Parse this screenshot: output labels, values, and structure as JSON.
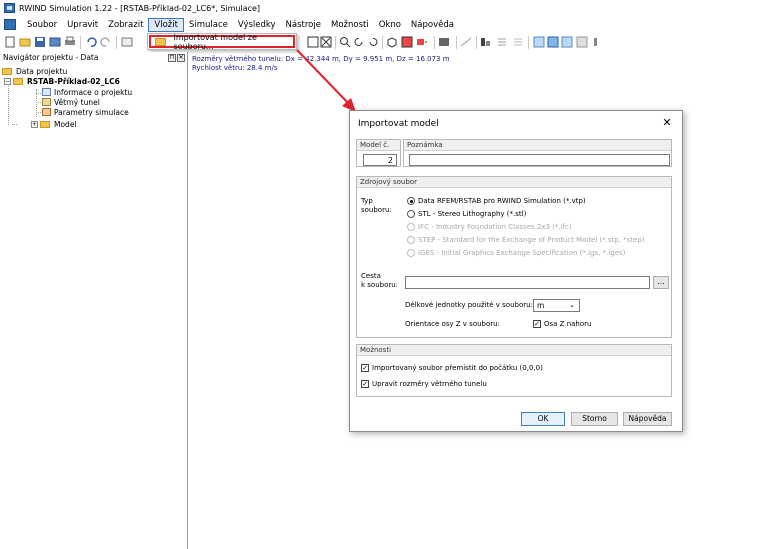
{
  "window": {
    "title": "RWIND Simulation 1.22 - [RSTAB-Příklad-02_LC6*, Simulace]"
  },
  "menu": {
    "items": [
      "Soubor",
      "Upravit",
      "Zobrazit",
      "Vložit",
      "Simulace",
      "Výsledky",
      "Nástroje",
      "Možnosti",
      "Okno",
      "Nápověda"
    ],
    "active_index": 3,
    "dropdown_item": "Importovat model ze souboru..."
  },
  "navigator": {
    "title": "Navigátor projektu - Data",
    "pin": "⊓",
    "close": "✕",
    "tree": {
      "root": "Data projektu",
      "project": "RSTAB-Příklad-02_LC6",
      "children": [
        "Informace o projektu",
        "Větrný tunel",
        "Parametry simulace",
        "Model"
      ]
    }
  },
  "info": {
    "line1": "Rozměry větrného tunelu: Dx = 42.344 m, Dy = 9.951 m, Dz = 16.073 m",
    "line2": "Rychlost větru: 28.4 m/s"
  },
  "dialog": {
    "title": "Importovat model",
    "close": "✕",
    "model": {
      "header": "Model č.",
      "value": "2"
    },
    "note": {
      "header": "Poznámka",
      "value": ""
    },
    "source": {
      "header": "Zdrojový soubor",
      "type_label_1": "Typ",
      "type_label_2": "souboru:",
      "options": [
        "Data RFEM/RSTAB pro RWIND Simulation (*.vtp)",
        "STL - Stereo Lithography (*.stl)",
        "IFC - Industry Foundation Classes 2x3 (*.ifc)",
        "STEP - Standard for the Exchange of Product Model (*.stp, *step)",
        "IGES - Initial Graphics Exchange Specification (*.igs, *.iges)"
      ],
      "selected_index": 0,
      "path_label_1": "Cesta",
      "path_label_2": "k souboru:",
      "path_value": "",
      "browse": "...",
      "units_label": "Délkové jednotky použité v souboru:",
      "units_value": "m",
      "axis_label": "Orientace osy Z v souboru:",
      "axis_check_label": "Osa Z nahoru",
      "axis_checked": true
    },
    "options": {
      "header": "Možnosti",
      "items": [
        {
          "label": "Importovaný soubor přemístit do počátku (0,0,0)",
          "checked": true
        },
        {
          "label": "Upravit rozměry větrného tunelu",
          "checked": true
        }
      ]
    },
    "buttons": {
      "ok": "OK",
      "cancel": "Storno",
      "help": "Nápověda"
    }
  },
  "colors": {
    "highlight": "#e0232a",
    "arrow": "#e0232a",
    "accent": "#3c7fd1"
  }
}
